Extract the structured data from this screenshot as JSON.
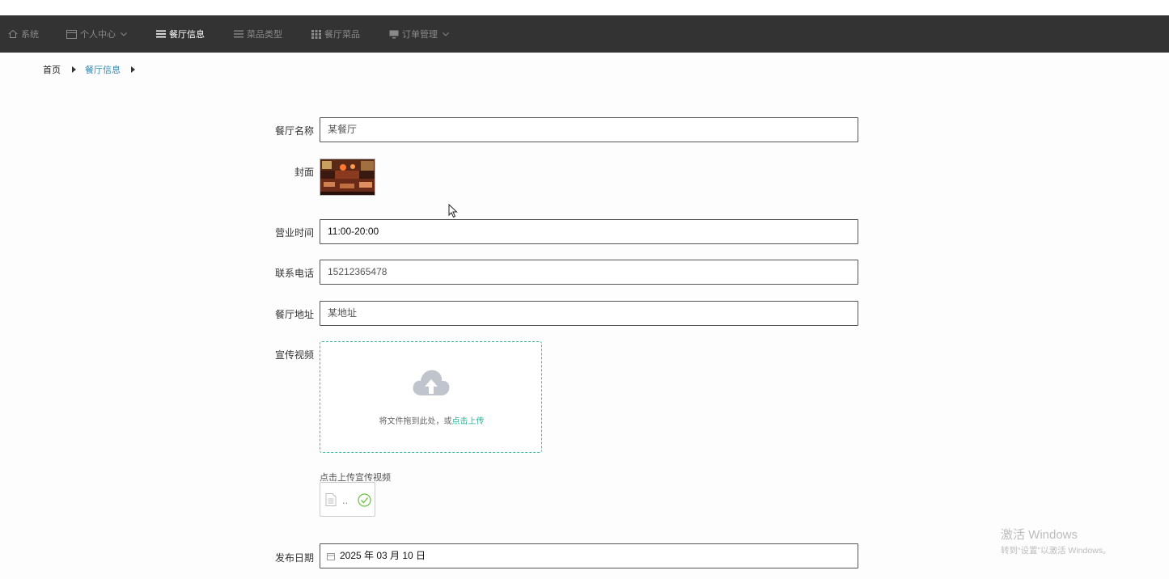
{
  "nav": {
    "items": [
      {
        "label": "系统",
        "icon": "home-icon"
      },
      {
        "label": "个人中心",
        "icon": "card-icon",
        "dropdown": true
      },
      {
        "label": "餐厅信息",
        "icon": "list-icon",
        "active": true
      },
      {
        "label": "菜品类型",
        "icon": "list-icon"
      },
      {
        "label": "餐厅菜品",
        "icon": "grid-icon"
      },
      {
        "label": "订单管理",
        "icon": "monitor-icon",
        "dropdown": true
      }
    ]
  },
  "breadcrumb": {
    "home": "首页",
    "current": "餐厅信息"
  },
  "form": {
    "name_label": "餐厅名称",
    "name_value": "某餐厅",
    "cover_label": "封面",
    "hours_label": "营业时间",
    "hours_value": "11:00-20:00",
    "phone_label": "联系电话",
    "phone_value": "15212365478",
    "address_label": "餐厅地址",
    "address_value": "某地址",
    "video_label": "宣传视频",
    "upload_text": "将文件拖到此处，或",
    "upload_link": "点击上传",
    "video_hint": "点击上传宣传视频",
    "file_placeholder": "..",
    "date_label": "发布日期",
    "date_value": "2025 年 03 月 10 日"
  },
  "watermark": {
    "title": "激活 Windows",
    "subtitle": "转到“设置”以激活 Windows。"
  },
  "colors": {
    "navbar_bg": "#333333",
    "nav_active": "#ffffff",
    "nav_inactive": "#8a8a8a",
    "breadcrumb_current": "#2e8bb0",
    "upload_border": "#3cb8a0",
    "upload_link": "#2bb19a"
  }
}
